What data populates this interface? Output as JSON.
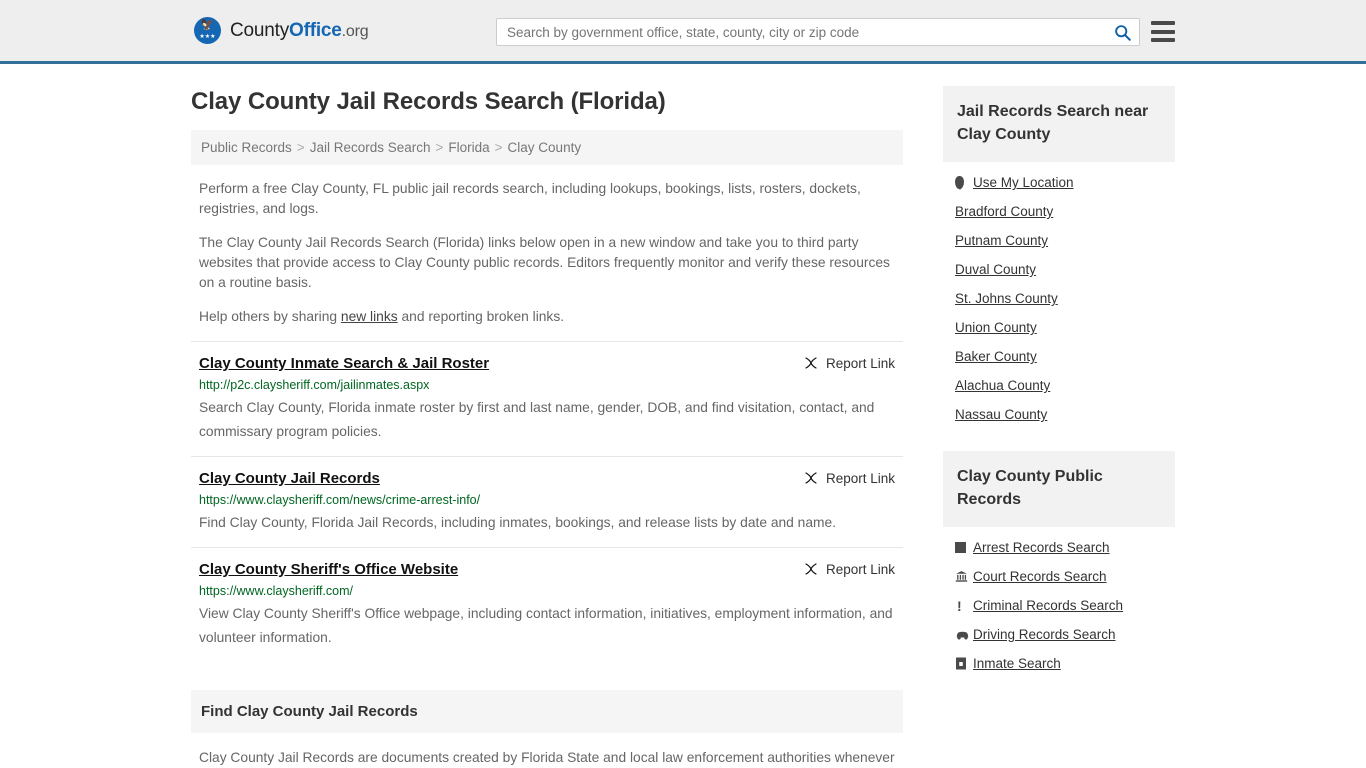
{
  "header": {
    "brand": {
      "part1": "County",
      "part2": "Office",
      "tld": ".org",
      "logo_icon": "eagle-shield-logo"
    },
    "search": {
      "placeholder": "Search by government office, state, county, city or zip code",
      "value": "",
      "icon": "search-icon"
    },
    "menu_icon": "hamburger-menu-icon",
    "accent_color": "#1567b3",
    "border_color": "#337099"
  },
  "main": {
    "page_title": "Clay County Jail Records Search (Florida)",
    "breadcrumb": [
      {
        "label": "Public Records"
      },
      {
        "label": "Jail Records Search"
      },
      {
        "label": "Florida"
      },
      {
        "label": "Clay County"
      }
    ],
    "breadcrumb_separator": ">",
    "intro_paragraphs": [
      "Perform a free Clay County, FL public jail records search, including lookups, bookings, lists, rosters, dockets, registries, and logs.",
      "The Clay County Jail Records Search (Florida) links below open in a new window and take you to third party websites that provide access to Clay County public records. Editors frequently monitor and verify these resources on a routine basis."
    ],
    "help_text_before": "Help others by sharing ",
    "help_link": "new links",
    "help_text_after": " and reporting broken links.",
    "report_link_label": "Report Link",
    "report_link_icon": "broken-link-icon",
    "results": [
      {
        "title": "Clay County Inmate Search & Jail Roster",
        "url": "http://p2c.claysheriff.com/jailinmates.aspx",
        "description": "Search Clay County, Florida inmate roster by first and last name, gender, DOB, and find visitation, contact, and commissary program policies."
      },
      {
        "title": "Clay County Jail Records",
        "url": "https://www.claysheriff.com/news/crime-arrest-info/",
        "description": "Find Clay County, Florida Jail Records, including inmates, bookings, and release lists by date and name."
      },
      {
        "title": "Clay County Sheriff's Office Website",
        "url": "https://www.claysheriff.com/",
        "description": "View Clay County Sheriff's Office webpage, including contact information, initiatives, employment information, and volunteer information."
      }
    ],
    "find_section": {
      "heading": "Find Clay County Jail Records",
      "paragraph": "Clay County Jail Records are documents created by Florida State and local law enforcement authorities whenever"
    },
    "url_color": "#006621"
  },
  "sidebar": {
    "near_section": {
      "heading": "Jail Records Search near Clay County",
      "items": [
        {
          "label": "Use My Location",
          "icon": "location-pin-icon"
        },
        {
          "label": "Bradford County",
          "icon": ""
        },
        {
          "label": "Putnam County",
          "icon": ""
        },
        {
          "label": "Duval County",
          "icon": ""
        },
        {
          "label": "St. Johns County",
          "icon": ""
        },
        {
          "label": "Union County",
          "icon": ""
        },
        {
          "label": "Baker County",
          "icon": ""
        },
        {
          "label": "Alachua County",
          "icon": ""
        },
        {
          "label": "Nassau County",
          "icon": ""
        }
      ]
    },
    "public_records_section": {
      "heading": "Clay County Public Records",
      "items": [
        {
          "label": "Arrest Records Search",
          "icon": "square-icon"
        },
        {
          "label": "Court Records Search",
          "icon": "courthouse-icon"
        },
        {
          "label": "Criminal Records Search",
          "icon": "exclamation-icon"
        },
        {
          "label": "Driving Records Search",
          "icon": "car-icon"
        },
        {
          "label": "Inmate Search",
          "icon": "jail-icon"
        }
      ]
    }
  }
}
